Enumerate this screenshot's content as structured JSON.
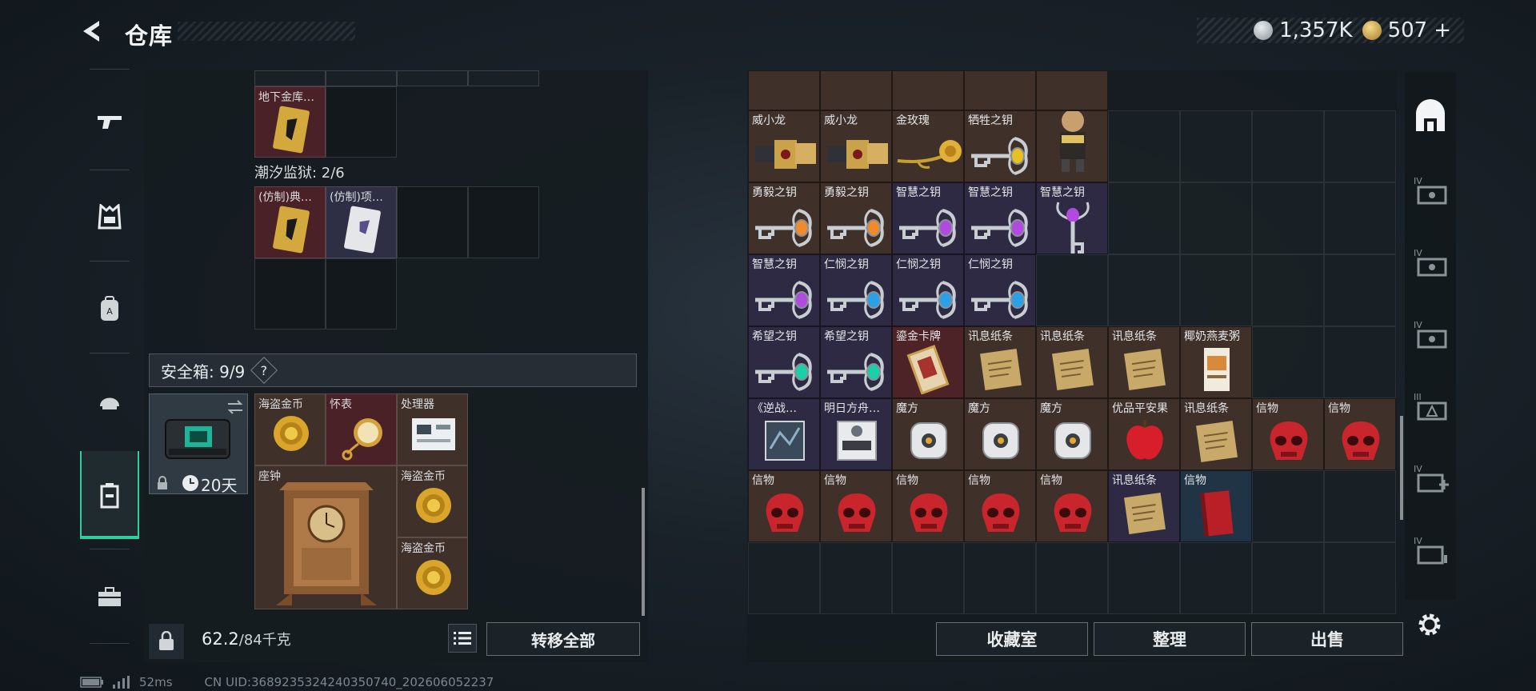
{
  "header": {
    "title": "仓库",
    "currency": [
      {
        "icon": "silver-coin-icon",
        "value": "1,357K",
        "color": "#c9ced2"
      },
      {
        "icon": "gold-coin-icon",
        "value": "507",
        "suffix": "+",
        "color": "#d9b25a"
      }
    ]
  },
  "left_nav": [
    {
      "icon": "gun-icon",
      "active": false
    },
    {
      "icon": "armor-vest-icon",
      "active": false
    },
    {
      "icon": "backpack-icon",
      "active": false
    },
    {
      "icon": "helmet-icon",
      "active": false
    },
    {
      "icon": "safe-container-icon",
      "active": true
    },
    {
      "icon": "toolbox-icon",
      "active": false
    }
  ],
  "left_panel": {
    "vault_item_label": "地下金库…",
    "prison_label": "潮汐监狱: 2/6",
    "prison_items": [
      "(仿制)典…",
      "(仿制)项…"
    ],
    "safe_title": "安全箱: 9/9",
    "safe_help": "?",
    "safe_timer": "20天",
    "safe_items": [
      {
        "label": "海盗金币",
        "kind": "coin"
      },
      {
        "label": "怀表",
        "kind": "watch"
      },
      {
        "label": "处理器",
        "kind": "processor"
      },
      {
        "label": "座钟",
        "kind": "clock"
      },
      {
        "label": "海盗金币",
        "kind": "coin"
      },
      {
        "label": "海盗金币",
        "kind": "coin"
      }
    ],
    "weight_current": "62.2",
    "weight_total": "/84千克",
    "transfer_all": "转移全部"
  },
  "right_panel": {
    "rows": [
      [
        {
          "label": "威小龙",
          "bg": "brown",
          "icon": "dragon-figure"
        },
        {
          "label": "威小龙",
          "bg": "brown",
          "icon": "dragon-figure"
        },
        {
          "label": "金玫瑰",
          "bg": "brown",
          "icon": "gold-rose"
        },
        {
          "label": "牺牲之钥",
          "bg": "brown",
          "icon": "key",
          "gem": "#e8c020"
        },
        {
          "label": "",
          "bg": "brown",
          "icon": "toy-figure"
        }
      ],
      [
        {
          "label": "勇毅之钥",
          "bg": "brown",
          "icon": "key",
          "gem": "#f08a2a"
        },
        {
          "label": "勇毅之钥",
          "bg": "brown",
          "icon": "key",
          "gem": "#f08a2a"
        },
        {
          "label": "智慧之钥",
          "bg": "purple",
          "icon": "key",
          "gem": "#b04ae0"
        },
        {
          "label": "智慧之钥",
          "bg": "purple",
          "icon": "key",
          "gem": "#b04ae0"
        },
        {
          "label": "智慧之钥",
          "bg": "purple",
          "icon": "key-vertical",
          "gem": "#b04ae0"
        }
      ],
      [
        {
          "label": "智慧之钥",
          "bg": "purple",
          "icon": "key",
          "gem": "#b04ae0"
        },
        {
          "label": "仁悯之钥",
          "bg": "purple",
          "icon": "key",
          "gem": "#2aa0e8"
        },
        {
          "label": "仁悯之钥",
          "bg": "purple",
          "icon": "key",
          "gem": "#2aa0e8"
        },
        {
          "label": "仁悯之钥",
          "bg": "purple",
          "icon": "key",
          "gem": "#2aa0e8"
        }
      ],
      [
        {
          "label": "希望之钥",
          "bg": "purple",
          "icon": "key",
          "gem": "#1ad0a8"
        },
        {
          "label": "希望之钥",
          "bg": "purple",
          "icon": "key",
          "gem": "#1ad0a8"
        },
        {
          "label": "鎏金卡牌",
          "bg": "red",
          "icon": "card"
        },
        {
          "label": "讯息纸条",
          "bg": "brown",
          "icon": "paper"
        },
        {
          "label": "讯息纸条",
          "bg": "brown",
          "icon": "paper"
        },
        {
          "label": "讯息纸条",
          "bg": "brown",
          "icon": "paper"
        },
        {
          "label": "椰奶燕麦粥",
          "bg": "brown",
          "icon": "oat-box"
        }
      ],
      [
        {
          "label": "《逆战…",
          "bg": "purple",
          "icon": "book-dark"
        },
        {
          "label": "明日方舟…",
          "bg": "purple",
          "icon": "book-light"
        },
        {
          "label": "魔方",
          "bg": "brown",
          "icon": "cube"
        },
        {
          "label": "魔方",
          "bg": "brown",
          "icon": "cube"
        },
        {
          "label": "魔方",
          "bg": "brown",
          "icon": "cube"
        },
        {
          "label": "优品平安果",
          "bg": "brown",
          "icon": "apple"
        },
        {
          "label": "讯息纸条",
          "bg": "brown",
          "icon": "paper"
        },
        {
          "label": "信物",
          "bg": "brown",
          "icon": "skull"
        },
        {
          "label": "信物",
          "bg": "brown",
          "icon": "skull"
        }
      ],
      [
        {
          "label": "信物",
          "bg": "brown",
          "icon": "skull"
        },
        {
          "label": "信物",
          "bg": "brown",
          "icon": "skull"
        },
        {
          "label": "信物",
          "bg": "brown",
          "icon": "skull"
        },
        {
          "label": "信物",
          "bg": "brown",
          "icon": "skull"
        },
        {
          "label": "信物",
          "bg": "brown",
          "icon": "skull"
        },
        {
          "label": "讯息纸条",
          "bg": "purple",
          "icon": "paper"
        },
        {
          "label": "信物",
          "bg": "blue",
          "icon": "red-book"
        }
      ]
    ],
    "buttons": {
      "collection": "收藏室",
      "sort": "整理",
      "sell": "出售"
    }
  },
  "right_nav": [
    {
      "icon": "house-icon",
      "label": ""
    },
    {
      "icon": "storage-iv-icon",
      "label": "IV"
    },
    {
      "icon": "storage-iv-icon",
      "label": "IV"
    },
    {
      "icon": "storage-iv-icon",
      "label": "IV"
    },
    {
      "icon": "storage-iii-icon",
      "label": "III"
    },
    {
      "icon": "storage-iv-plus-icon",
      "label": "IV"
    },
    {
      "icon": "storage-iv-icon",
      "label": "IV"
    }
  ],
  "status": {
    "ping": "52ms",
    "uid": "CN UID:3689235324240350740_202606052237"
  }
}
